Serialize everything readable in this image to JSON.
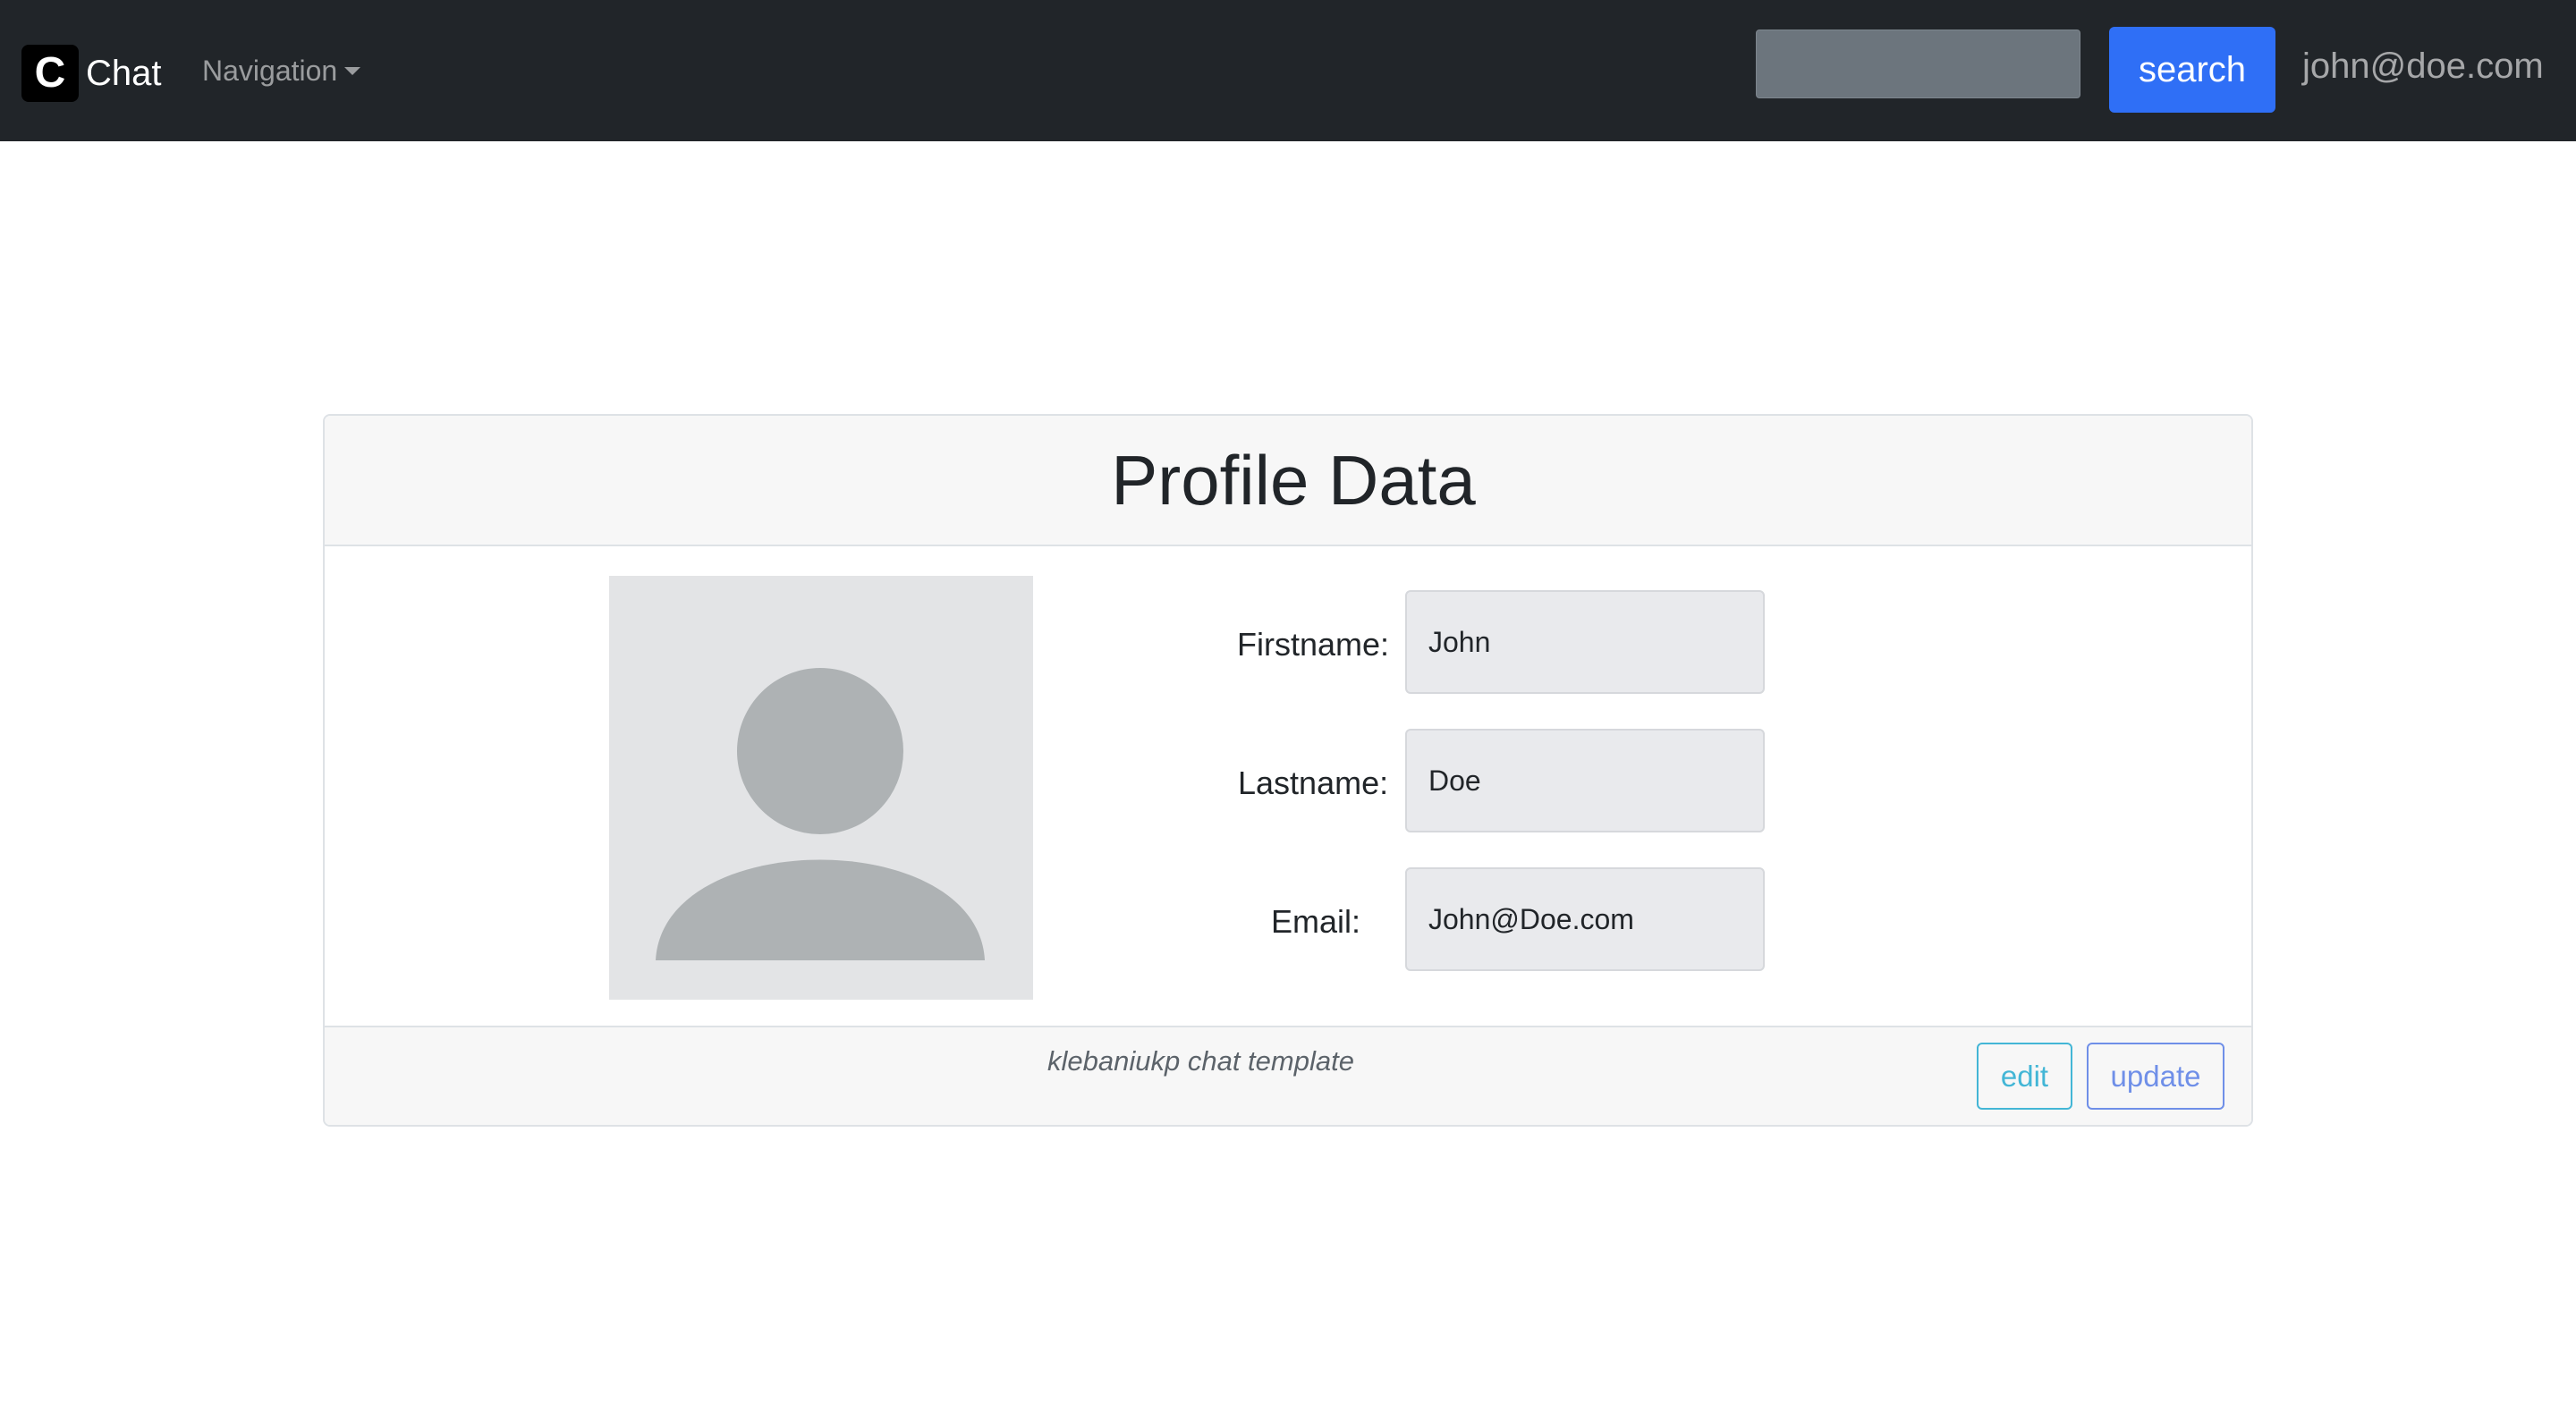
{
  "navbar": {
    "brand": {
      "logo_letter": "C",
      "name": "Chat"
    },
    "nav_dropdown_label": "Navigation",
    "search": {
      "placeholder": "",
      "value": "",
      "button_label": "search"
    },
    "user_email": "john@doe.com",
    "colors": {
      "background": "#212529",
      "search_button": "#2f6ff6"
    }
  },
  "profile_card": {
    "title": "Profile Data",
    "avatar_icon": "person-silhouette-icon",
    "fields": [
      {
        "label": "Firstname:",
        "value": "John"
      },
      {
        "label": "Lastname:",
        "value": "Doe"
      },
      {
        "label": "Email:",
        "value": "John@Doe.com"
      }
    ],
    "footer_text": "klebaniukp chat template",
    "buttons": {
      "edit": "edit",
      "update": "update"
    },
    "colors": {
      "edit": "#43b6d6",
      "update": "#6f8fe8"
    }
  }
}
